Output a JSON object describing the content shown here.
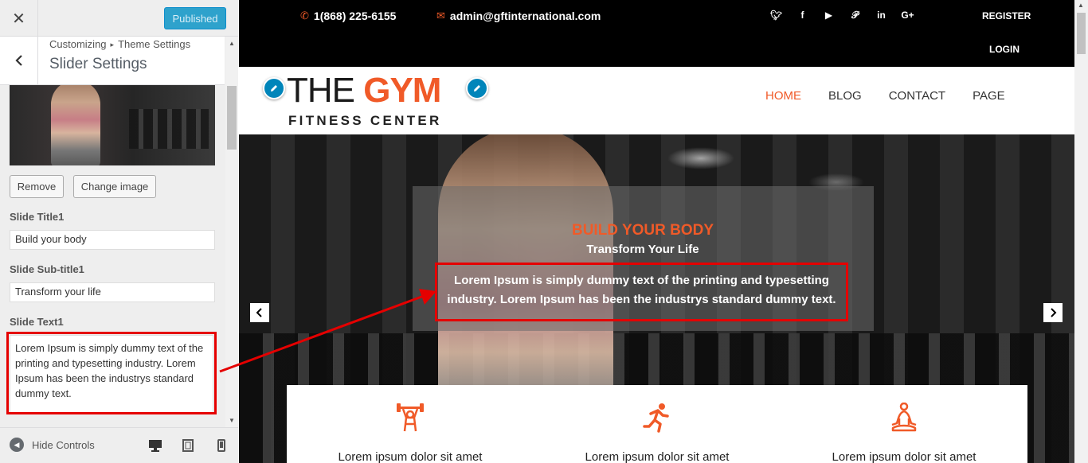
{
  "customizer": {
    "close_icon": "close-icon",
    "publish_label": "Published",
    "breadcrumb": [
      "Customizing",
      "Theme Settings"
    ],
    "section_title": "Slider Settings",
    "remove_label": "Remove",
    "change_image_label": "Change image",
    "fields": {
      "title_label": "Slide Title1",
      "title_value": "Build your body",
      "subtitle_label": "Slide Sub-title1",
      "subtitle_value": "Transform your life",
      "text_label": "Slide Text1",
      "text_value": "Lorem Ipsum is simply dummy text of the printing and typesetting industry. Lorem Ipsum has been the industrys standard dummy text."
    },
    "hide_controls_label": "Hide Controls"
  },
  "preview": {
    "phone": "1(868) 225-6155",
    "email": "admin@gftinternational.com",
    "social": [
      "twitter-icon",
      "facebook-icon",
      "youtube-icon",
      "pinterest-icon",
      "linkedin-icon",
      "google-plus-icon"
    ],
    "register": "REGISTER",
    "login": "LOGIN",
    "logo": {
      "the": "THE",
      "gym": "GYM",
      "tagline": "FITNESS CENTER"
    },
    "nav": [
      "HOME",
      "BLOG",
      "CONTACT",
      "PAGE"
    ],
    "slide": {
      "title": "BUILD YOUR BODY",
      "subtitle": "Transform Your Life",
      "text": "Lorem Ipsum is simply dummy text of the printing and typesetting industry. Lorem Ipsum has been the industrys standard dummy text."
    },
    "features": [
      "Lorem ipsum dolor sit amet",
      "Lorem ipsum dolor sit amet",
      "Lorem ipsum dolor sit amet"
    ]
  },
  "colors": {
    "accent": "#f05a28",
    "publish": "#2ea2cc",
    "highlight": "#e50000",
    "topbar": "#000000"
  }
}
